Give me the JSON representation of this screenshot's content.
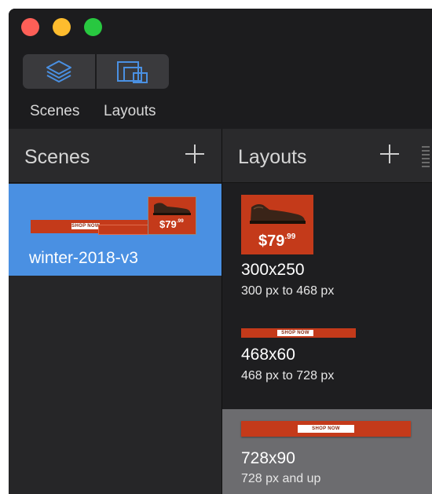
{
  "window": {
    "controls": [
      "close",
      "minimize",
      "maximize"
    ]
  },
  "toolbar": {
    "segments": [
      {
        "label": "Scenes",
        "icon": "layers-icon",
        "selected": true
      },
      {
        "label": "Layouts",
        "icon": "layouts-icon",
        "selected": false
      }
    ]
  },
  "scenes_pane": {
    "title": "Scenes",
    "add_icon": "plus-icon",
    "items": [
      {
        "name": "winter-2018-v3",
        "selected": true,
        "thumb": {
          "shop_label": "SHOP NOW",
          "price": "$79",
          "cents": ".99"
        }
      }
    ]
  },
  "layouts_pane": {
    "title": "Layouts",
    "add_icon": "plus-icon",
    "items": [
      {
        "size": "300x250",
        "range": "300 px to 468 px",
        "thumb": {
          "price": "$79",
          "cents": ".99"
        }
      },
      {
        "size": "468x60",
        "range": "468 px to 728 px",
        "thumb": {
          "shop_label": "SHOP NOW"
        }
      },
      {
        "size": "728x90",
        "range": "728 px and up",
        "thumb": {
          "shop_label": "SHOP NOW"
        },
        "selected": true
      }
    ]
  },
  "colors": {
    "selection_blue": "#4a90e2",
    "ad_red": "#c43a1a",
    "icon_blue": "#4a90e2"
  }
}
